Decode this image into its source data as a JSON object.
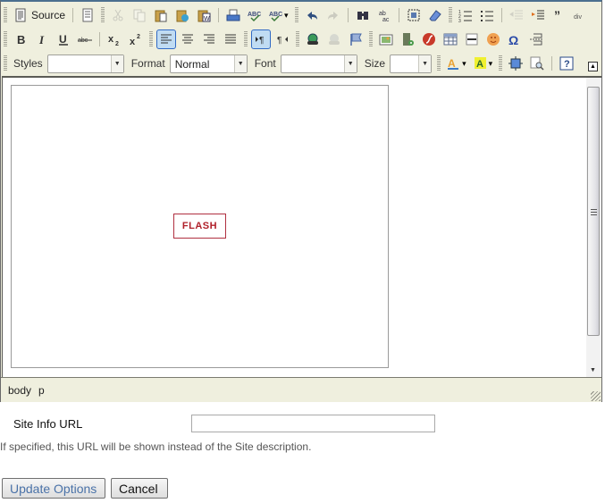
{
  "editor": {
    "toolbar": {
      "row1": [
        {
          "name": "source-button",
          "icon": "document-source-icon",
          "label": "Source"
        },
        {
          "sep": true
        },
        {
          "name": "templates-button",
          "icon": "templates-icon"
        },
        {
          "grip": true
        },
        {
          "name": "cut-button",
          "icon": "scissors-icon",
          "disabled": true
        },
        {
          "name": "copy-button",
          "icon": "copy-icon",
          "disabled": true
        },
        {
          "name": "paste-button",
          "icon": "paste-icon"
        },
        {
          "name": "paste-text-button",
          "icon": "paste-text-icon"
        },
        {
          "name": "paste-word-button",
          "icon": "paste-word-icon"
        },
        {
          "sep": true
        },
        {
          "name": "print-button",
          "icon": "printer-icon"
        },
        {
          "name": "spellcheck-button",
          "icon": "spellcheck-icon"
        },
        {
          "name": "scayt-button",
          "icon": "spellcheck-dropdown-icon"
        },
        {
          "grip": true
        },
        {
          "name": "undo-button",
          "icon": "undo-icon"
        },
        {
          "name": "redo-button",
          "icon": "redo-icon",
          "disabled": true
        },
        {
          "sep": true
        },
        {
          "name": "find-button",
          "icon": "binoculars-icon"
        },
        {
          "name": "replace-button",
          "icon": "replace-icon"
        },
        {
          "sep": true
        },
        {
          "name": "select-all-button",
          "icon": "select-all-icon"
        },
        {
          "name": "remove-format-button",
          "icon": "eraser-icon"
        },
        {
          "grip": true
        },
        {
          "name": "numbered-list-button",
          "icon": "numbered-list-icon"
        },
        {
          "name": "bulleted-list-button",
          "icon": "bulleted-list-icon"
        },
        {
          "sep": true
        },
        {
          "name": "outdent-button",
          "icon": "outdent-icon",
          "disabled": true
        },
        {
          "name": "indent-button",
          "icon": "indent-icon"
        },
        {
          "name": "blockquote-button",
          "icon": "blockquote-icon"
        },
        {
          "name": "create-div-button",
          "icon": "div-icon"
        }
      ],
      "row2": [
        {
          "name": "bold-button",
          "icon": "bold-icon"
        },
        {
          "name": "italic-button",
          "icon": "italic-icon"
        },
        {
          "name": "underline-button",
          "icon": "underline-icon"
        },
        {
          "name": "strike-button",
          "icon": "strikethrough-icon"
        },
        {
          "sep": true
        },
        {
          "name": "subscript-button",
          "icon": "subscript-icon"
        },
        {
          "name": "superscript-button",
          "icon": "superscript-icon"
        },
        {
          "grip": true
        },
        {
          "name": "align-left-button",
          "icon": "align-left-icon",
          "on": true
        },
        {
          "name": "align-center-button",
          "icon": "align-center-icon"
        },
        {
          "name": "align-right-button",
          "icon": "align-right-icon"
        },
        {
          "name": "justify-button",
          "icon": "align-justify-icon"
        },
        {
          "grip": true
        },
        {
          "name": "ltr-button",
          "icon": "text-direction-ltr-icon",
          "on": true
        },
        {
          "name": "rtl-button",
          "icon": "text-direction-rtl-icon"
        },
        {
          "grip": true
        },
        {
          "name": "link-button",
          "icon": "link-globe-icon"
        },
        {
          "name": "unlink-button",
          "icon": "unlink-icon",
          "disabled": true
        },
        {
          "name": "anchor-button",
          "icon": "flag-icon"
        },
        {
          "grip": true
        },
        {
          "name": "image-button",
          "icon": "image-icon"
        },
        {
          "name": "media-button",
          "icon": "film-icon"
        },
        {
          "name": "flash-button",
          "icon": "flash-icon"
        },
        {
          "name": "table-button",
          "icon": "table-icon"
        },
        {
          "name": "horizontal-rule-button",
          "icon": "horizontal-rule-icon"
        },
        {
          "name": "smiley-button",
          "icon": "smiley-icon"
        },
        {
          "name": "special-char-button",
          "icon": "omega-icon"
        },
        {
          "name": "page-break-button",
          "icon": "page-break-icon"
        }
      ],
      "row3": {
        "styles_label": "Styles",
        "styles_value": "",
        "format_label": "Format",
        "format_value": "Normal",
        "font_label": "Font",
        "font_value": "",
        "size_label": "Size",
        "size_value": ""
      },
      "row3_buttons": [
        {
          "name": "text-color-button",
          "icon": "text-color-icon"
        },
        {
          "name": "bg-color-button",
          "icon": "background-color-icon"
        },
        {
          "name": "maximize-button",
          "icon": "maximize-icon"
        },
        {
          "name": "show-blocks-button",
          "icon": "show-blocks-icon"
        },
        {
          "name": "about-button",
          "icon": "help-icon"
        }
      ]
    },
    "content": {
      "flash_placeholder": "FLASH"
    },
    "path": [
      "body",
      "p"
    ]
  },
  "form": {
    "site_info_label": "Site Info URL",
    "site_info_value": "",
    "help_text": "If specified, this URL will be shown instead of the Site description.",
    "update_button": "Update Options",
    "cancel_button": "Cancel"
  }
}
